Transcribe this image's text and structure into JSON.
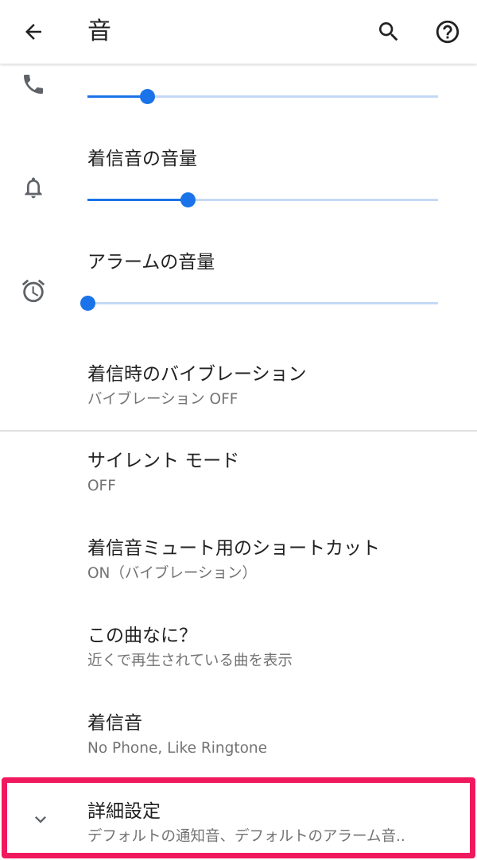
{
  "appbar": {
    "title": "音",
    "back_icon": "arrow-back-icon",
    "search_icon": "search-icon",
    "help_icon": "help-circle-icon"
  },
  "volumes": {
    "call": {
      "icon": "phone-icon",
      "label": "",
      "level": 0.17
    },
    "ringer": {
      "icon": "bell-icon",
      "label": "着信音の音量",
      "level": 0.285
    },
    "alarm": {
      "icon": "alarm-clock-icon",
      "label": "アラームの音量",
      "level": 0.0
    }
  },
  "prefs": {
    "vibrate": {
      "title": "着信時のバイブレーション",
      "summary": "バイブレーション OFF"
    },
    "dnd": {
      "title": "サイレント モード",
      "summary": "OFF"
    },
    "mute_shortcut": {
      "title": "着信音ミュート用のショートカット",
      "summary": "ON（バイブレーション）"
    },
    "now_playing": {
      "title": "この曲なに？",
      "summary": "近くで再生されている曲を表示"
    },
    "ringtone": {
      "title": "着信音",
      "summary": "No Phone, Like Ringtone"
    },
    "advanced": {
      "title": "詳細設定",
      "summary": "デフォルトの通知音、デフォルトのアラーム音.."
    }
  },
  "colors": {
    "accent": "#1a73e8",
    "track": "#c5d9f7",
    "highlight": "#f0195e"
  }
}
